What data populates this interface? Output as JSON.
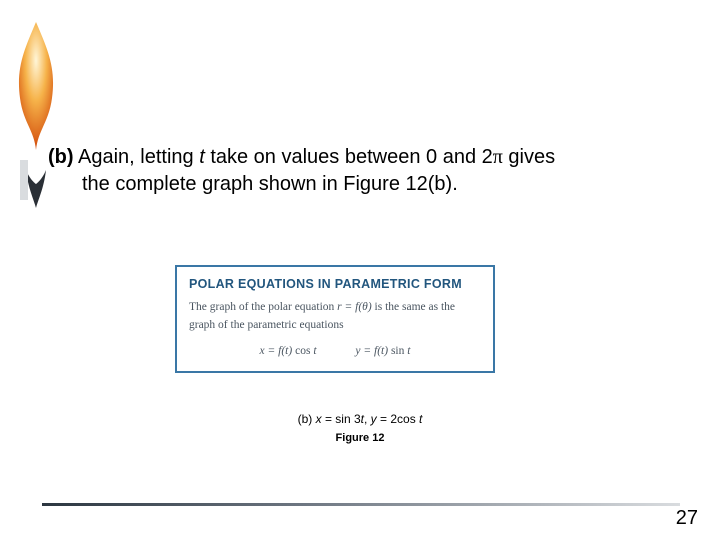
{
  "body": {
    "label": "(b)",
    "line1_part1": " Again, letting ",
    "line1_t": "t",
    "line1_part2": " take on values between 0 and 2",
    "line1_pi": "π",
    "line1_part3": " gives",
    "line2": "the complete graph shown in Figure 12(b)."
  },
  "box": {
    "title": "POLAR EQUATIONS IN PARAMETRIC FORM",
    "body_part1": "The graph of the polar equation ",
    "body_eq": "r = f(θ)",
    "body_part2": " is the same as the graph of the parametric equations",
    "eq1_lhs": "x = f(t) ",
    "eq1_fn": "cos",
    "eq1_rhs": " t",
    "eq2_lhs": "y = f(t) ",
    "eq2_fn": "sin",
    "eq2_rhs": " t"
  },
  "caption": {
    "line1_prefix": "(b) ",
    "line1_x": "x",
    "line1_mid1": " = sin 3",
    "line1_t1": "t",
    "line1_mid2": ", ",
    "line1_y": "y",
    "line1_mid3": " = 2cos ",
    "line1_t2": "t",
    "line2": "Figure 12"
  },
  "page": "27"
}
